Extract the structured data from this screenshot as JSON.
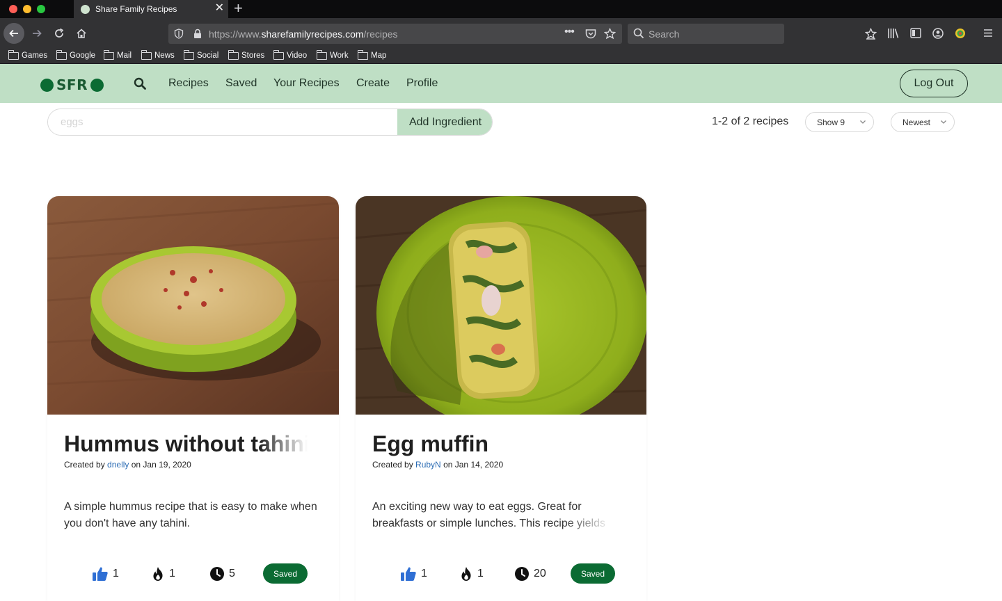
{
  "browser": {
    "tab_title": "Share Family Recipes",
    "url_prefix": "https://www.",
    "url_domain": "sharefamilyrecipes.com",
    "url_path": "/recipes",
    "search_placeholder": "Search",
    "bookmarks": [
      "Games",
      "Google",
      "Mail",
      "News",
      "Social",
      "Stores",
      "Video",
      "Work",
      "Map"
    ]
  },
  "header": {
    "logo_text": "SFR",
    "menu": [
      "Recipes",
      "Saved",
      "Your Recipes",
      "Create",
      "Profile"
    ],
    "logout_label": "Log Out",
    "brand_color": "#0b6b33",
    "header_color": "#bfdfc5"
  },
  "filters": {
    "ingredient_placeholder": "eggs",
    "add_ingredient_label": "Add Ingredient",
    "result_count": "1-2 of 2 recipes",
    "show_select": "Show 9",
    "sort_select": "Newest"
  },
  "recipes": [
    {
      "title": "Hummus without tahini",
      "created_by_prefix": "Created by",
      "author": "dnelly",
      "date_text": "on Jan 19, 2020",
      "description": "A simple hummus recipe that is easy to make when you don't have any tahini.",
      "likes": "1",
      "hot": "1",
      "time": "5",
      "saved_label": "Saved",
      "image": "hummus-in-green-bowl"
    },
    {
      "title": "Egg muffin",
      "created_by_prefix": "Created by",
      "author": "RubyN",
      "date_text": "on Jan 14, 2020",
      "description": "An exciting new way to eat eggs. Great for breakfasts or simple lunches. This recipe yields",
      "likes": "1",
      "hot": "1",
      "time": "20",
      "saved_label": "Saved",
      "image": "egg-muffin-on-green-plate"
    }
  ]
}
